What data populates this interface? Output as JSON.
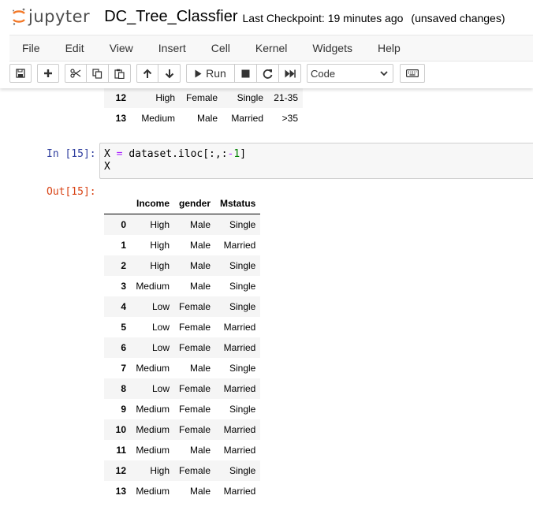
{
  "header": {
    "logo_text": "jupyter",
    "notebook_name": "DC_Tree_Classfier",
    "checkpoint": "Last Checkpoint: 19 minutes ago",
    "autosave": "(unsaved changes)"
  },
  "menu": [
    "File",
    "Edit",
    "View",
    "Insert",
    "Cell",
    "Kernel",
    "Widgets",
    "Help"
  ],
  "toolbar": {
    "run_label": "Run",
    "cell_type": "Code"
  },
  "top_table": {
    "rows": [
      {
        "index": "12",
        "cells": [
          "High",
          "Female",
          "Single",
          "21-35"
        ]
      },
      {
        "index": "13",
        "cells": [
          "Medium",
          "Male",
          "Married",
          ">35"
        ]
      }
    ]
  },
  "cell": {
    "in_prompt": "In [15]:",
    "code_var": "X",
    "code_assign": " = ",
    "code_expr_a": "dataset.iloc[:,:",
    "code_minus": "-",
    "code_num": "1",
    "code_close": "]",
    "code_line2": "X",
    "out_prompt": "Out[15]:"
  },
  "output_table": {
    "columns": [
      "Income",
      "gender",
      "Mstatus"
    ],
    "rows": [
      {
        "index": "0",
        "cells": [
          "High",
          "Male",
          "Single"
        ]
      },
      {
        "index": "1",
        "cells": [
          "High",
          "Male",
          "Married"
        ]
      },
      {
        "index": "2",
        "cells": [
          "High",
          "Male",
          "Single"
        ]
      },
      {
        "index": "3",
        "cells": [
          "Medium",
          "Male",
          "Single"
        ]
      },
      {
        "index": "4",
        "cells": [
          "Low",
          "Female",
          "Single"
        ]
      },
      {
        "index": "5",
        "cells": [
          "Low",
          "Female",
          "Married"
        ]
      },
      {
        "index": "6",
        "cells": [
          "Low",
          "Female",
          "Married"
        ]
      },
      {
        "index": "7",
        "cells": [
          "Medium",
          "Male",
          "Single"
        ]
      },
      {
        "index": "8",
        "cells": [
          "Low",
          "Female",
          "Married"
        ]
      },
      {
        "index": "9",
        "cells": [
          "Medium",
          "Female",
          "Single"
        ]
      },
      {
        "index": "10",
        "cells": [
          "Medium",
          "Female",
          "Married"
        ]
      },
      {
        "index": "11",
        "cells": [
          "Medium",
          "Male",
          "Married"
        ]
      },
      {
        "index": "12",
        "cells": [
          "High",
          "Female",
          "Single"
        ]
      },
      {
        "index": "13",
        "cells": [
          "Medium",
          "Male",
          "Married"
        ]
      }
    ]
  },
  "colors": {
    "in_prompt": "#303f9f",
    "out_prompt": "#d84315",
    "logo_orange": "#f37726"
  }
}
